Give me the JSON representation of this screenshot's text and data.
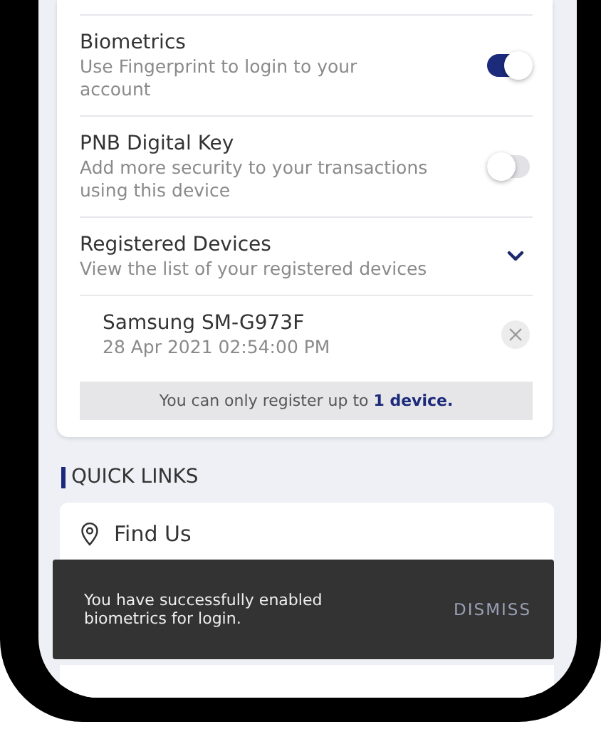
{
  "settings": [
    {
      "kind": "toggle",
      "title": "Biometrics",
      "subtitle": "Use Fingerprint to login to your account",
      "on": true
    },
    {
      "kind": "toggle",
      "title": "PNB Digital Key",
      "subtitle": "Add more security to your transactions using this device",
      "on": false
    },
    {
      "kind": "expand",
      "title": "Registered Devices",
      "subtitle": "View the list of your registered devices",
      "expanded": true,
      "children": [
        {
          "name": "Samsung SM-G973F",
          "date": "28 Apr 2021 02:54:00 PM"
        }
      ]
    }
  ],
  "notice": "You can only register up to **1 device.**",
  "quick_links": {
    "heading": "QUICK LINKS",
    "items": [
      {
        "label": "Find Us"
      }
    ]
  },
  "snackbar": {
    "message": "You have successfully enabled biometrics for login.",
    "action": "DISMISS"
  }
}
